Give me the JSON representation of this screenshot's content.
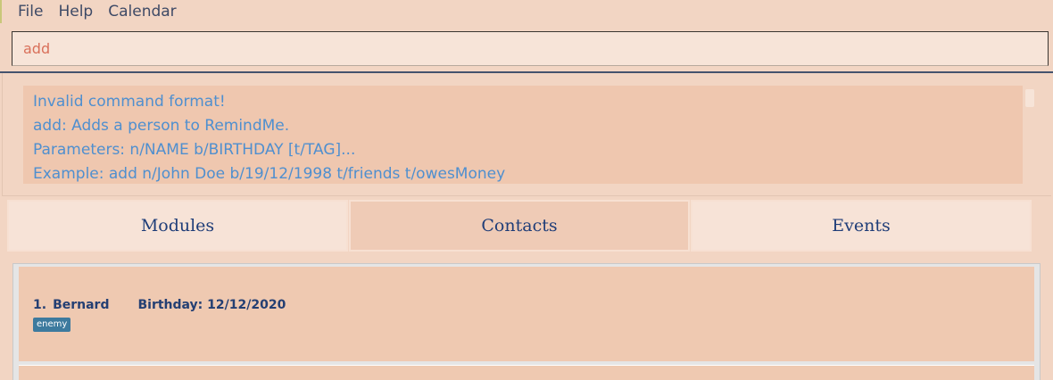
{
  "menu": {
    "items": [
      "File",
      "Help",
      "Calendar"
    ]
  },
  "command": {
    "value": "add"
  },
  "result": {
    "lines": [
      "Invalid command format!",
      "add: Adds a person to RemindMe.",
      "Parameters: n/NAME b/BIRTHDAY [t/TAG]...",
      "Example: add n/John Doe b/19/12/1998 t/friends t/owesMoney"
    ]
  },
  "tabs": [
    {
      "label": "Modules",
      "active": false
    },
    {
      "label": "Contacts",
      "active": true
    },
    {
      "label": "Events",
      "active": false
    }
  ],
  "contacts": [
    {
      "index": "1.",
      "name": "Bernard",
      "birthday": "Birthday: 12/12/2020",
      "tags": [
        "enemy"
      ]
    }
  ],
  "colors": {
    "background": "#f2d5c3",
    "result_text": "#4f8fcf",
    "command_text": "#d9705a",
    "tab_text": "#1f3d78",
    "tag_bg": "#3d7a9e"
  }
}
